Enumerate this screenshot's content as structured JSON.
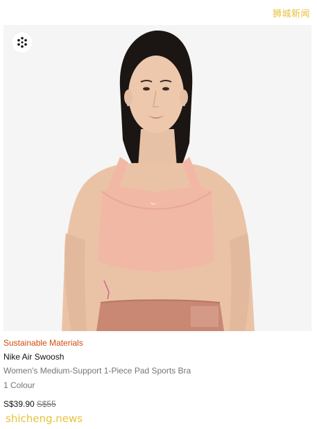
{
  "watermark_top": "狮城新闻",
  "watermark_bottom": "shicheng.news",
  "product": {
    "badge_icon": "sustainable-swoosh-icon",
    "promo": "Sustainable Materials",
    "name": "Nike Air Swoosh",
    "subtitle": "Women's Medium-Support 1-Piece Pad Sports Bra",
    "colours": "1 Colour",
    "price": "S$39.90",
    "original_price": "S$55",
    "colors": {
      "promo": "#d14b0a",
      "bra": "#f2b8a6",
      "shorts": "#c98874",
      "background": "#f5f5f5"
    }
  }
}
